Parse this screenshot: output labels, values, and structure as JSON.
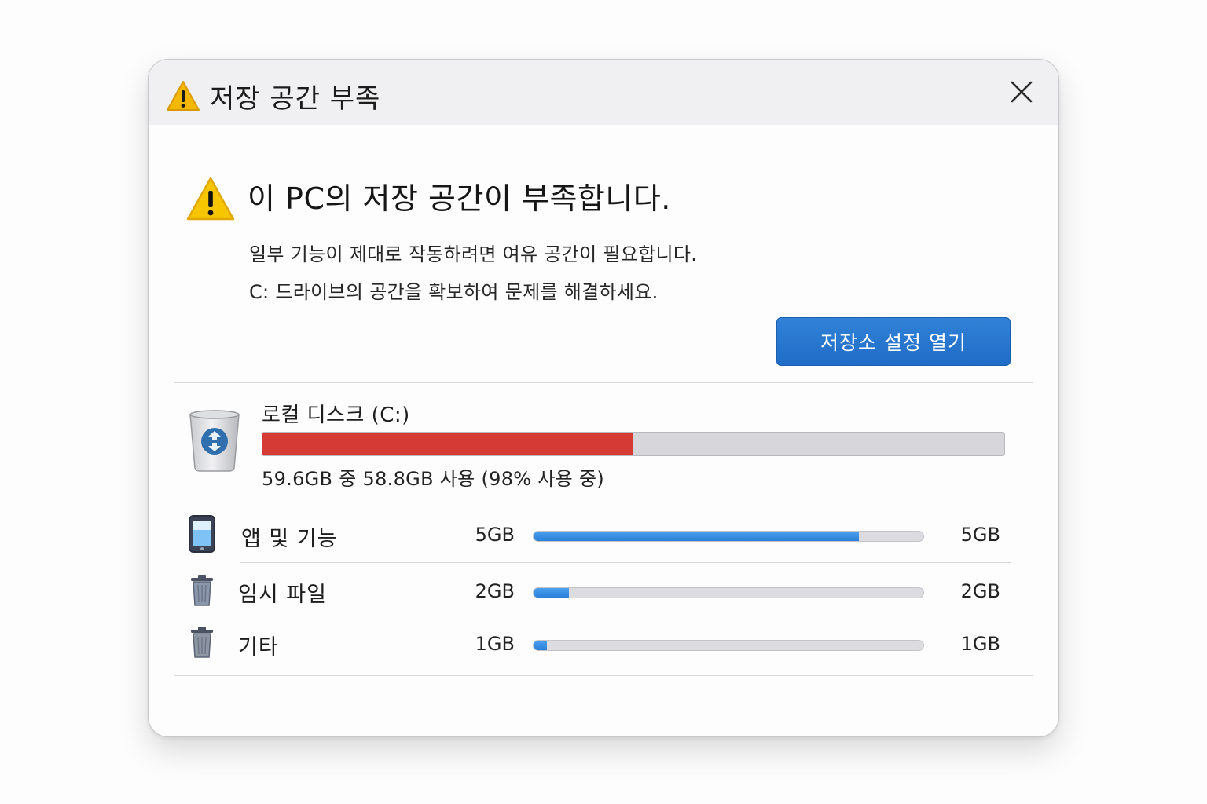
{
  "window": {
    "title": "저장 공간 부족",
    "close_label": "닫기"
  },
  "alert": {
    "headline": "이 PC의 저장 공간이 부족합니다.",
    "description_line1": "일부 기능이 제대로 작동하려면 여유 공간이 필요합니다.",
    "description_line2": "C: 드라이브의 공간을 확보하여 문제를 해결하세요.",
    "button_label": "저장소 설정 열기"
  },
  "disk": {
    "name": "로컬 디스크 (C:)",
    "usage_text": "59.6GB 중 58.8GB 사용 (98% 사용 중)",
    "used_fraction": 0.5,
    "bar_color": "#d63a35"
  },
  "categories": [
    {
      "name": "앱 및 기능",
      "size_left": "5GB",
      "size_right": "5GB",
      "fill_fraction": 0.835,
      "icon": "phone-icon"
    },
    {
      "name": "임시 파일",
      "size_left": "2GB",
      "size_right": "2GB",
      "fill_fraction": 0.09,
      "icon": "trash-icon"
    },
    {
      "name": "기타",
      "size_left": "1GB",
      "size_right": "1GB",
      "fill_fraction": 0.035,
      "icon": "trash-icon"
    }
  ],
  "colors": {
    "accent": "#1f6cc6",
    "warning": "#f5b800",
    "danger": "#d63a35",
    "progress": "#2a7fd8"
  }
}
